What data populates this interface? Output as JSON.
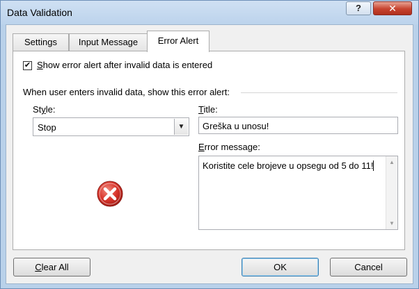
{
  "window": {
    "title": "Data Validation",
    "help_label": "?",
    "close_label": "✕"
  },
  "tabs": [
    {
      "label": "Settings",
      "active": false
    },
    {
      "label": "Input Message",
      "active": false
    },
    {
      "label": "Error Alert",
      "active": true
    }
  ],
  "error_alert": {
    "show_alert_checkbox": {
      "checked": true,
      "check_mark": "✔",
      "mnemonic": "S",
      "label_rest": "how error alert after invalid data is entered"
    },
    "section_label": "When user enters invalid data, show this error alert:",
    "style": {
      "mnemonic": "Y",
      "label_rest": ":",
      "label_prefix": "St",
      "label_suffix": "le:",
      "value": "Stop",
      "arrow": "▼"
    },
    "icon": "stop-error-icon",
    "title": {
      "mnemonic": "T",
      "label_rest": "itle:",
      "value": "Greška u unosu!"
    },
    "error_message": {
      "mnemonic": "E",
      "label_rest": "rror message:",
      "value": "Koristite cele brojeve u opsegu od 5 do 11!"
    }
  },
  "buttons": {
    "clear_all_mnemonic": "C",
    "clear_all_rest": "lear All",
    "ok": "OK",
    "cancel": "Cancel"
  },
  "colors": {
    "stop_red": "#d9342b",
    "frame": "#b9d1ea"
  }
}
